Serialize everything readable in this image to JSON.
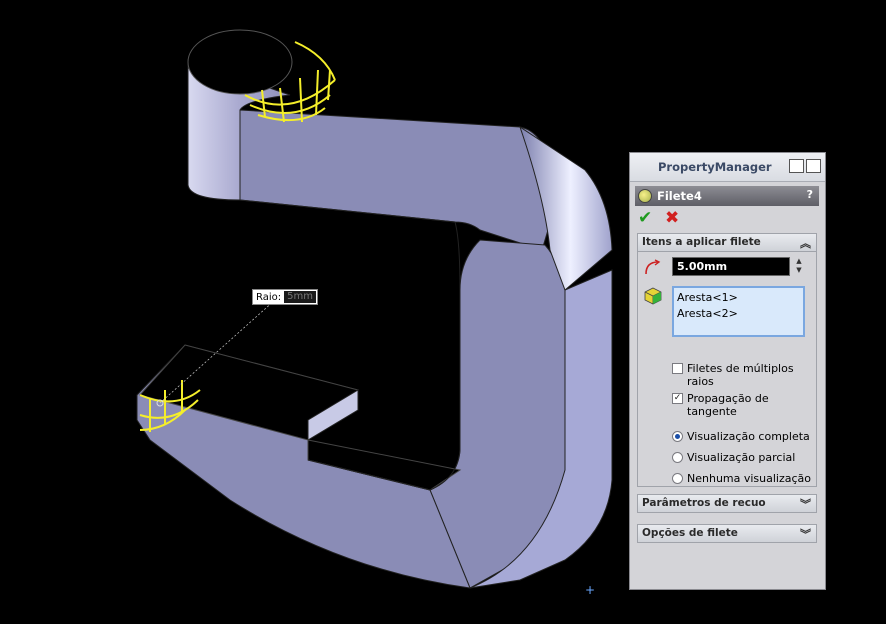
{
  "viewport": {
    "radius_callout": {
      "label": "Raio:",
      "value": "5mm"
    },
    "cursor_icon": "crosshair-plus-icon"
  },
  "property_manager": {
    "title": "PropertyManager",
    "header_icons": [
      "display-options-icon",
      "pin-icon"
    ],
    "feature": {
      "name": "Filete4",
      "icon": "fillet-feature-icon",
      "help": "?"
    },
    "ok_icon": "checkmark-icon",
    "cancel_icon": "close-x-icon",
    "groups": {
      "items": {
        "title": "Itens a aplicar filete",
        "radius_value": "5.00mm",
        "edges": [
          "Aresta<1>",
          "Aresta<2>"
        ],
        "multi_radius": {
          "label": "Filetes de múltiplos raios",
          "checked": false
        },
        "tangent": {
          "label_line1": "Propagação de",
          "label_line2": "tangente",
          "checked": true
        },
        "preview_options": [
          {
            "label": "Visualização completa",
            "selected": true
          },
          {
            "label": "Visualização parcial",
            "selected": false
          },
          {
            "label": "Nenhuma visualização",
            "selected": false
          }
        ]
      },
      "setback": {
        "title": "Parâmetros de recuo"
      },
      "options": {
        "title": "Opções de filete"
      }
    }
  },
  "colors": {
    "background": "#000000",
    "model_face": "#8a8cb6",
    "preview_edge": "#f4ee2a",
    "panel": "#d4d4d8"
  }
}
